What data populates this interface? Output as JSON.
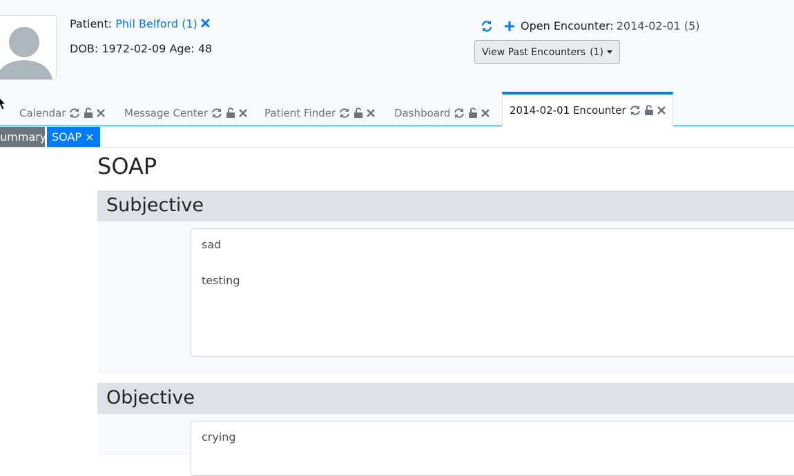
{
  "patient": {
    "label": "Patient:",
    "name": "Phil Belford (1)",
    "dob_line": "DOB: 1972-02-09 Age: 48"
  },
  "encounter": {
    "label": "Open Encounter:",
    "value": "2014-02-01 (5)",
    "past_button": "View Past Encounters",
    "past_count": "(1)"
  },
  "tabs": [
    {
      "label": "Calendar"
    },
    {
      "label": "Message Center"
    },
    {
      "label": "Patient Finder"
    },
    {
      "label": "Dashboard"
    },
    {
      "label": "2014-02-01 Encounter"
    }
  ],
  "subtabs": {
    "summary": "ummary",
    "soap": "SOAP ×"
  },
  "page": {
    "title": "SOAP"
  },
  "sections": {
    "subjective": {
      "title": "Subjective",
      "text": "sad\n\ntesting"
    },
    "objective": {
      "title": "Objective",
      "text": "crying"
    }
  },
  "colors": {
    "accent": "#007bff",
    "section_header": "#dee2e6",
    "summary_tab": "#6c757d"
  }
}
